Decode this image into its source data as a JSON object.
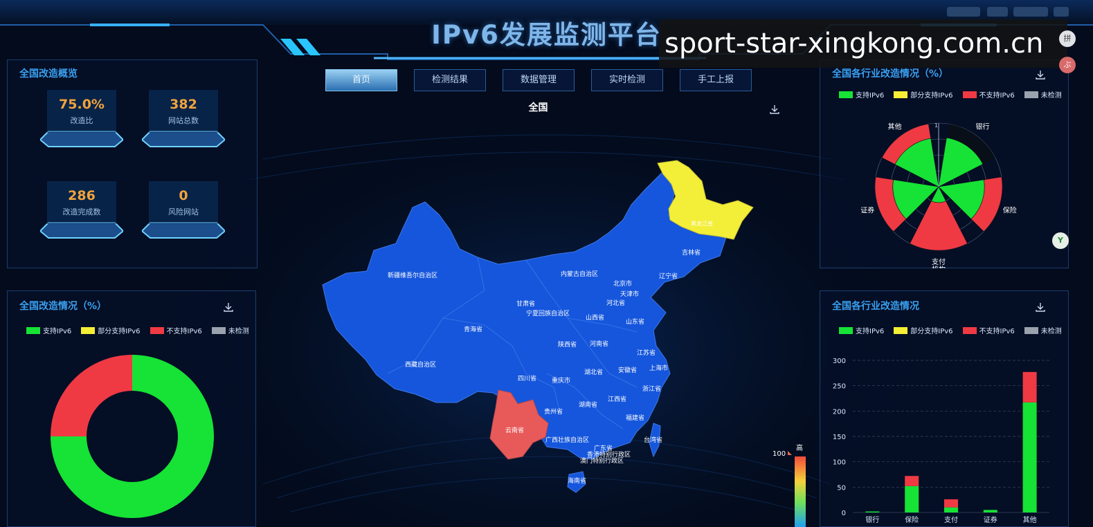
{
  "header": {
    "title": "IPv6发展监测平台"
  },
  "watermark": "sport-star-xingkong.com.cn",
  "side_buttons": [
    "拼",
    "ぶ",
    "Y"
  ],
  "nav": [
    {
      "label": "首页",
      "active": true
    },
    {
      "label": "检测结果",
      "active": false
    },
    {
      "label": "数据管理",
      "active": false
    },
    {
      "label": "实时检测",
      "active": false
    },
    {
      "label": "手工上报",
      "active": false
    }
  ],
  "overview": {
    "title": "全国改造概览",
    "kpis": [
      {
        "value": "75.0%",
        "label": "改造比"
      },
      {
        "value": "382",
        "label": "网站总数"
      },
      {
        "value": "286",
        "label": "改造完成数"
      },
      {
        "value": "0",
        "label": "风险网站"
      }
    ]
  },
  "legend": {
    "items": [
      {
        "label": "支持IPv6",
        "color": "#16e335"
      },
      {
        "label": "部分支持IPv6",
        "color": "#f5ee35"
      },
      {
        "label": "不支持IPv6",
        "color": "#ef3a44"
      },
      {
        "label": "未检测",
        "color": "#9aa3ad"
      }
    ]
  },
  "status_panel": {
    "title": "全国改造情况（%）"
  },
  "map": {
    "title": "全国",
    "visual_map": {
      "max_label": "100",
      "high_label": "高"
    },
    "region_colors": {
      "default": "#1556dc",
      "heilongjiang": "#f3ee38",
      "yunnan": "#e85a5a",
      "border": "#3e78e8"
    },
    "labels": [
      "新疆维吾尔自治区",
      "西藏自治区",
      "青海省",
      "甘肃省",
      "宁夏回族自治区",
      "内蒙古自治区",
      "黑龙江省",
      "吉林省",
      "辽宁省",
      "北京市",
      "天津市",
      "河北省",
      "山西省",
      "山东省",
      "陕西省",
      "河南省",
      "江苏省",
      "上海市",
      "安徽省",
      "湖北省",
      "四川省",
      "重庆市",
      "浙江省",
      "江西省",
      "湖南省",
      "贵州省",
      "云南省",
      "福建省",
      "台湾省",
      "广西壮族自治区",
      "广东省",
      "香港特别行政区",
      "澳门特别行政区",
      "海南省"
    ]
  },
  "industry_panel": {
    "title": "全国各行业改造情况（%）"
  },
  "industry_bar_panel": {
    "title": "全国各行业改造情况"
  },
  "chart_data": [
    {
      "type": "pie",
      "subtype": "donut",
      "title": "全国改造情况（%）",
      "slices": [
        {
          "name": "支持IPv6",
          "value": 75.0,
          "color": "#16e335"
        },
        {
          "name": "不支持IPv6",
          "value": 25.0,
          "color": "#ef3a44"
        }
      ]
    },
    {
      "type": "polar_stacked_bar",
      "title": "全国各行业改造情况（%）",
      "categories": [
        "银行",
        "保险",
        "支付机构",
        "证券",
        "其他"
      ],
      "radial_max_label": "1",
      "series": [
        {
          "name": "支持IPv6",
          "color": "#16e335",
          "values": [
            0.78,
            0.72,
            0.25,
            0.72,
            0.77
          ]
        },
        {
          "name": "不支持IPv6",
          "color": "#ef3a44",
          "values": [
            0.0,
            0.28,
            0.75,
            0.28,
            0.23
          ]
        }
      ]
    },
    {
      "type": "bar",
      "stacked": true,
      "title": "全国各行业改造情况",
      "categories": [
        "银行",
        "保险",
        "支付",
        "证券",
        "其他"
      ],
      "ylim": [
        0,
        300
      ],
      "yticks": [
        0,
        50,
        100,
        150,
        200,
        250,
        300
      ],
      "grid": true,
      "series": [
        {
          "name": "支持IPv6",
          "color": "#16e335",
          "values": [
            2,
            52,
            10,
            5,
            217
          ]
        },
        {
          "name": "不支持IPv6",
          "color": "#ef3a44",
          "values": [
            0,
            20,
            16,
            0,
            60
          ]
        }
      ]
    }
  ]
}
